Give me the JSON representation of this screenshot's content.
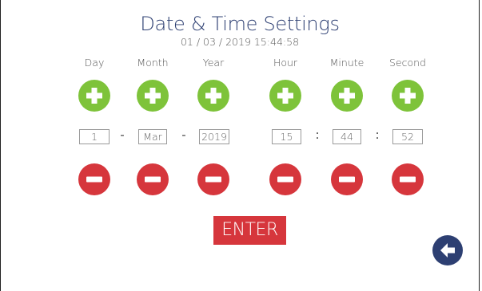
{
  "header": {
    "title": "Date & Time Settings",
    "current_datetime": "01 / 03 / 2019  15:44:58"
  },
  "columns": {
    "day": {
      "label": "Day",
      "value": "1"
    },
    "month": {
      "label": "Month",
      "value": "Mar"
    },
    "year": {
      "label": "Year",
      "value": "2019"
    },
    "hour": {
      "label": "Hour",
      "value": "15"
    },
    "minute": {
      "label": "Minute",
      "value": "44"
    },
    "second": {
      "label": "Second",
      "value": "52"
    }
  },
  "separators": {
    "date": "-",
    "time": ":"
  },
  "actions": {
    "enter_label": "ENTER"
  },
  "icons": {
    "increment": "plus-icon",
    "decrement": "minus-icon",
    "back": "arrow-left-icon"
  },
  "colors": {
    "title": "#2d3f72",
    "increment": "#7ec33a",
    "decrement": "#d6363c",
    "enter": "#d6363c",
    "back": "#2d3f72"
  }
}
